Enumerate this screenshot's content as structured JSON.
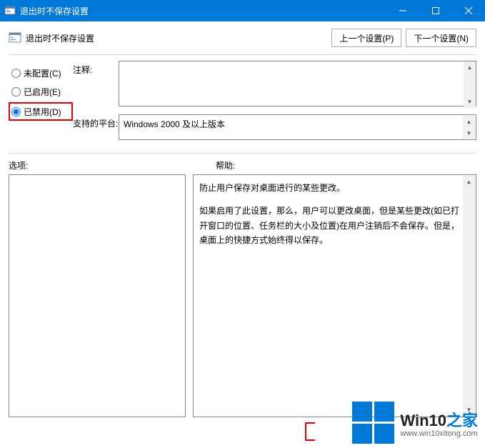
{
  "window": {
    "title": "退出时不保存设置"
  },
  "header": {
    "title": "退出时不保存设置",
    "prev_btn": "上一个设置(P)",
    "next_btn": "下一个设置(N)"
  },
  "radios": {
    "not_configured": "未配置(C)",
    "enabled": "已启用(E)",
    "disabled": "已禁用(D)",
    "selected": "disabled"
  },
  "fields": {
    "comment_label": "注释:",
    "comment_value": "",
    "platform_label": "支持的平台:",
    "platform_value": "Windows 2000 及以上版本"
  },
  "lower": {
    "options_label": "选项:",
    "help_label": "帮助:",
    "help_p1": "防止用户保存对桌面进行的某些更改。",
    "help_p2": "如果启用了此设置，那么，用户可以更改桌面，但是某些更改(如已打开窗口的位置、任务栏的大小及位置)在用户注销后不会保存。但是，桌面上的快捷方式始终得以保存。"
  },
  "watermark": {
    "brand_a": "Win10",
    "brand_b": "之家",
    "url": "www.win10xitong.com"
  }
}
